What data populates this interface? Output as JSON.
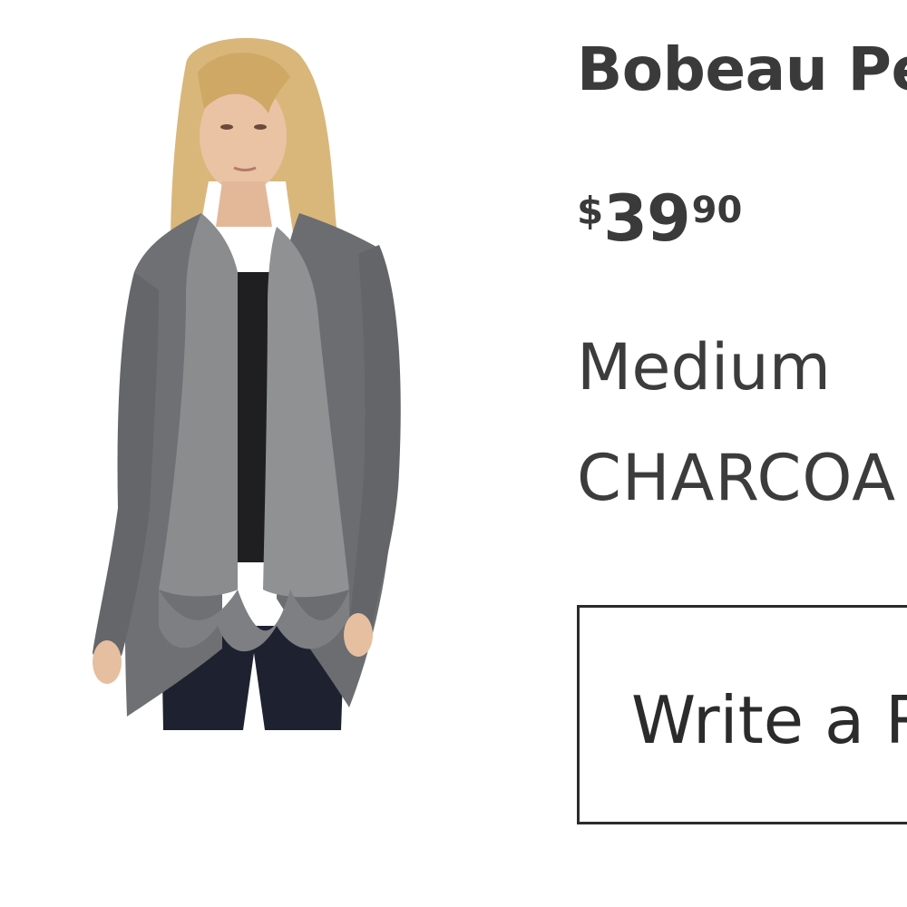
{
  "product": {
    "title": "Bobeau Pe",
    "price": {
      "currency": "$",
      "dollars": "39",
      "cents": "90"
    },
    "size": "Medium",
    "color": "CHARCOA",
    "image_icon": "product-photo-cardigan"
  },
  "actions": {
    "review_label": "Write a R"
  }
}
